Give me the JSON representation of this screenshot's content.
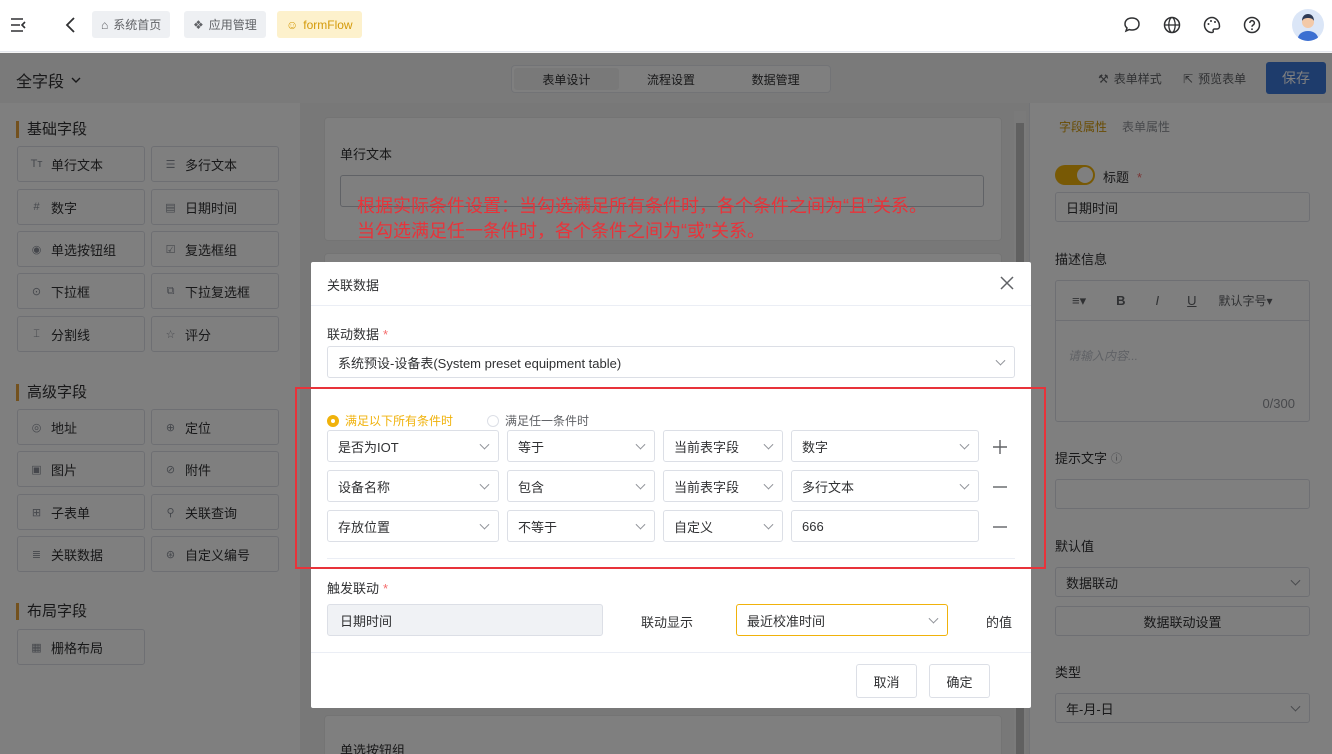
{
  "topbar": {
    "tags": [
      "系统首页",
      "应用管理",
      "formFlow"
    ]
  },
  "subbar": {
    "field_filter": "全字段",
    "tabs": [
      "表单设计",
      "流程设置",
      "数据管理"
    ],
    "form_style": "表单样式",
    "preview": "预览表单",
    "save": "保存"
  },
  "left_panel": {
    "groups": [
      {
        "title": "基础字段",
        "items": [
          {
            "icon": "text-icon",
            "label": "单行文本"
          },
          {
            "icon": "multiline-icon",
            "label": "多行文本"
          },
          {
            "icon": "hash-icon",
            "label": "数字"
          },
          {
            "icon": "calendar-icon",
            "label": "日期时间"
          },
          {
            "icon": "radio-icon",
            "label": "单选按钮组"
          },
          {
            "icon": "checkbox-icon",
            "label": "复选框组"
          },
          {
            "icon": "dropdown-icon",
            "label": "下拉框"
          },
          {
            "icon": "multi-dropdown-icon",
            "label": "下拉复选框"
          },
          {
            "icon": "divider-icon",
            "label": "分割线"
          },
          {
            "icon": "star-icon",
            "label": "评分"
          }
        ]
      },
      {
        "title": "高级字段",
        "items": [
          {
            "icon": "address-icon",
            "label": "地址"
          },
          {
            "icon": "location-icon",
            "label": "定位"
          },
          {
            "icon": "image-icon",
            "label": "图片"
          },
          {
            "icon": "attachment-icon",
            "label": "附件"
          },
          {
            "icon": "subtable-icon",
            "label": "子表单"
          },
          {
            "icon": "search-icon",
            "label": "关联查询"
          },
          {
            "icon": "database-icon",
            "label": "关联数据"
          },
          {
            "icon": "serial-icon",
            "label": "自定义编号"
          }
        ]
      },
      {
        "title": "布局字段",
        "items": [
          {
            "icon": "grid-icon",
            "label": "栅格布局"
          }
        ]
      }
    ]
  },
  "canvas": {
    "card1_label": "单行文本",
    "card_bottom_label": "单选按钮组"
  },
  "annotation": {
    "line1": "根据实际条件设置：当勾选满足所有条件时，各个条件之间为“且”关系。",
    "line2": "当勾选满足任一条件时，各个条件之间为“或”关系。",
    "color": "#e8333a"
  },
  "right_panel": {
    "tabs": [
      "字段属性",
      "表单属性"
    ],
    "title_label": "标题",
    "title_value": "日期时间",
    "desc_label": "描述信息",
    "desc_placeholder": "请输入内容...",
    "desc_count": "0/300",
    "font_size": "默认字号",
    "hint_label": "提示文字",
    "default_label": "默认值",
    "default_value": "数据联动",
    "linkage_button": "数据联动设置",
    "type_label": "类型",
    "type_value": "年-月-日",
    "toggle_on": true
  },
  "dialog": {
    "title": "关联数据",
    "linkage_label": "联动数据",
    "linkage_value": "系统预设-设备表(System preset equipment table)",
    "radio_all": "满足以下所有条件时",
    "radio_any": "满足任一条件时",
    "radio_selected": "all",
    "conditions": [
      {
        "field": "是否为IOT",
        "op": "等于",
        "source": "当前表字段",
        "value": "数字",
        "value_is_select": true,
        "action": "plus"
      },
      {
        "field": "设备名称",
        "op": "包含",
        "source": "当前表字段",
        "value": "多行文本",
        "value_is_select": true,
        "action": "minus"
      },
      {
        "field": "存放位置",
        "op": "不等于",
        "source": "自定义",
        "value": "666",
        "value_is_select": false,
        "action": "minus"
      }
    ],
    "trigger_label": "触发联动",
    "trigger_value": "日期时间",
    "display_label": "联动显示",
    "display_value": "最近校准时间",
    "suffix": "的值",
    "cancel": "取消",
    "confirm": "确定"
  },
  "accent_color": "#f0b20b",
  "primary_color": "#3c78d8"
}
